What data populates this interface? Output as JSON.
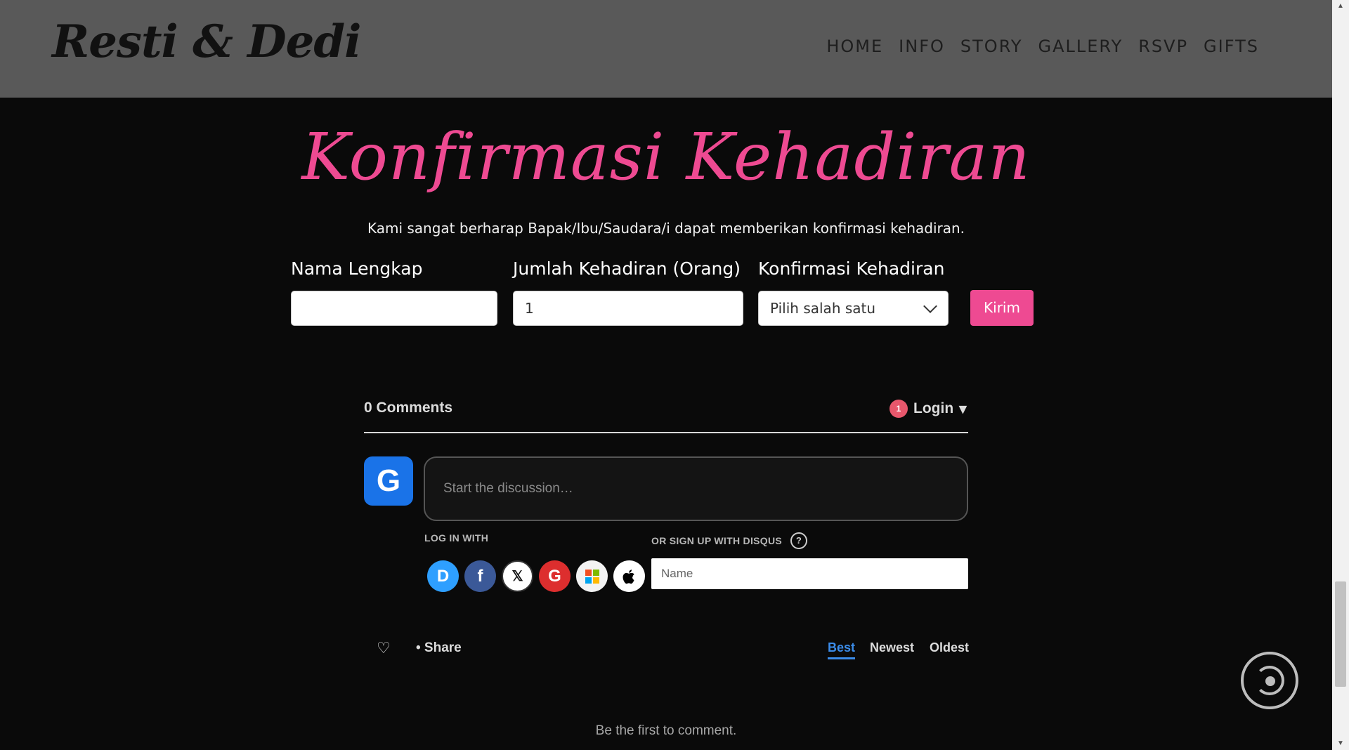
{
  "header": {
    "brand": "Resti & Dedi",
    "nav": [
      "HOME",
      "INFO",
      "STORY",
      "GALLERY",
      "RSVP",
      "GIFTS"
    ]
  },
  "rsvp": {
    "title": "Konfirmasi Kehadiran",
    "subtitle": "Kami sangat berharap Bapak/Ibu/Saudara/i dapat memberikan konfirmasi kehadiran.",
    "name_label": "Nama Lengkap",
    "name_value": "",
    "count_label": "Jumlah Kehadiran (Orang)",
    "count_value": "1",
    "confirm_label": "Konfirmasi Kehadiran",
    "confirm_selected": "Pilih salah satu",
    "submit_label": "Kirim",
    "accent_color": "#ee4a92"
  },
  "disqus": {
    "comment_count": "0 Comments",
    "notification_count": "1",
    "login_label": "Login",
    "login_caret": "▾",
    "avatar_letter": "G",
    "comment_placeholder": "Start the discussion…",
    "login_with_label": "LOG IN WITH",
    "signup_label": "OR SIGN UP WITH DISQUS",
    "help_glyph": "?",
    "providers": [
      "disqus",
      "facebook",
      "x",
      "google",
      "microsoft",
      "apple"
    ],
    "provider_glyphs": {
      "disqus": "D",
      "facebook": "f",
      "x": "𝕏",
      "google": "G",
      "apple": ""
    },
    "name_placeholder": "Name",
    "heart_glyph": "♡",
    "share_label": "• Share",
    "sort_options": [
      "Best",
      "Newest",
      "Oldest"
    ],
    "sort_selected": "Best",
    "empty_message": "Be the first to comment."
  },
  "icons": {
    "chevron": "chevron-down-icon",
    "floating_button": "audio-disc-icon"
  }
}
